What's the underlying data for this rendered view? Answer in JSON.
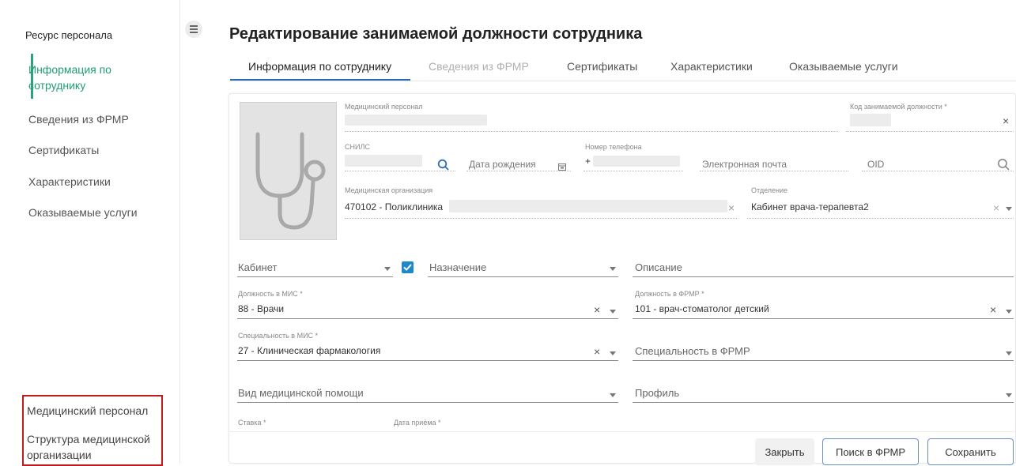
{
  "sidebar": {
    "title": "Ресурс персонала",
    "items": [
      {
        "label_line1": "Информация по",
        "label_line2": "сотруднику",
        "active": true
      },
      {
        "label": "Сведения из ФРМР"
      },
      {
        "label": "Сертификаты"
      },
      {
        "label": "Характеристики"
      },
      {
        "label": "Оказываемые услуги"
      }
    ],
    "bottom_links": {
      "medical_staff": "Медицинский персонал",
      "structure_line1": "Структура медицинской",
      "structure_line2": "организации"
    }
  },
  "header": {
    "title": "Редактирование занимаемой должности сотрудника"
  },
  "tabs": [
    {
      "label": "Информация по сотруднику",
      "state": "active"
    },
    {
      "label": "Сведения из ФРМР",
      "state": "disabled"
    },
    {
      "label": "Сертификаты",
      "state": "normal"
    },
    {
      "label": "Характеристики",
      "state": "normal"
    },
    {
      "label": "Оказываемые услуги",
      "state": "normal"
    }
  ],
  "form": {
    "medical_staff": {
      "label": "Медицинский персонал"
    },
    "position_code": {
      "label": "Код занимаемой должности *"
    },
    "snils": {
      "label": "СНИЛС"
    },
    "birth_date": {
      "placeholder": "Дата рождения"
    },
    "phone": {
      "label": "Номер телефона",
      "value_prefix": "+"
    },
    "email": {
      "placeholder": "Электронная почта"
    },
    "oid": {
      "placeholder": "OID"
    },
    "med_org": {
      "label": "Медицинская организация",
      "value": "470102 - Поликлиника"
    },
    "department": {
      "label": "Отделение",
      "value": "Кабинет врача-терапевта2"
    },
    "cabinet": {
      "placeholder": "Кабинет"
    },
    "assignment": {
      "placeholder": "Назначение"
    },
    "description": {
      "placeholder": "Описание"
    },
    "mis_position": {
      "label": "Должность в МИС *",
      "value": "88 - Врачи"
    },
    "frmr_position": {
      "label": "Должность в ФРМР *",
      "value": "101 - врач-стоматолог детский"
    },
    "mis_specialty": {
      "label": "Специальность в МИС *",
      "value": "27 - Клиническая фармакология"
    },
    "frmr_specialty": {
      "placeholder": "Специальность в ФРМР"
    },
    "care_type": {
      "placeholder": "Вид медицинской помощи"
    },
    "profile": {
      "placeholder": "Профиль"
    },
    "rate": {
      "label": "Ставка *"
    },
    "hire_date": {
      "label": "Дата приёма *"
    }
  },
  "buttons": {
    "close": "Закрыть",
    "frmr_search": "Поиск в ФРМР",
    "save": "Сохранить"
  },
  "colors": {
    "accent": "#1f9d73",
    "tab_active": "#2b6cb0",
    "checkbox": "#1e88c9",
    "highlight_box": "#c11c1c"
  },
  "icons": [
    "menu-icon",
    "stethoscope-icon",
    "search-icon",
    "calendar-icon",
    "close-icon",
    "chevron-down-icon",
    "checkbox-checked-icon"
  ]
}
